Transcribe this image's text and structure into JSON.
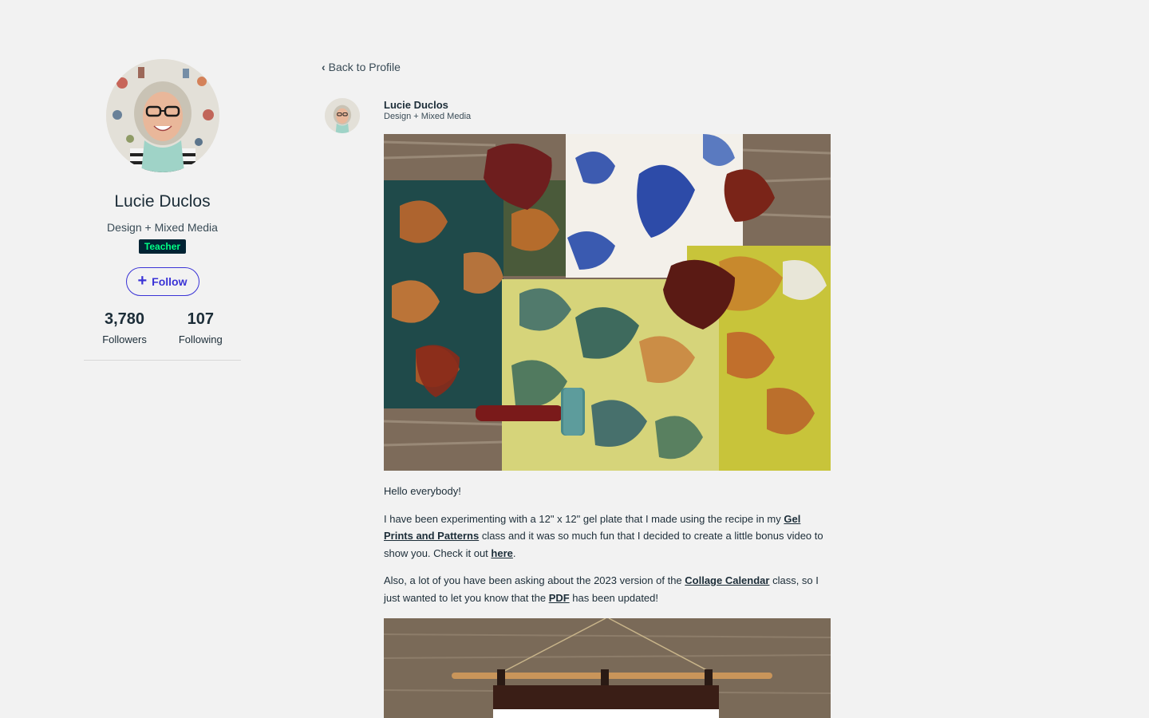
{
  "profile": {
    "name": "Lucie Duclos",
    "subtitle": "Design + Mixed Media",
    "badge": "Teacher",
    "follow_label": "Follow",
    "followers_count": "3,780",
    "followers_label": "Followers",
    "following_count": "107",
    "following_label": "Following"
  },
  "nav": {
    "back_label": "Back to Profile"
  },
  "post": {
    "author_name": "Lucie Duclos",
    "author_subtitle": "Design + Mixed Media",
    "greeting": "Hello everybody!",
    "p1_a": "I have been experimenting with a 12\" x 12\" gel plate that I made using the recipe in my ",
    "p1_link1": "Gel Prints and Patterns",
    "p1_b": " class and it was so much fun that I decided to create a little bonus video to show you. Check it out ",
    "p1_link2": "here",
    "p1_c": ".",
    "p2_a": "Also, a lot of you have been asking about the 2023 version of the ",
    "p2_link1": "Collage Calendar",
    "p2_b": " class, so I just wanted to let you know that the ",
    "p2_link2": "PDF",
    "p2_c": " has been updated!"
  },
  "colors": {
    "background": "#f2f2f2",
    "accent": "#3a33d6",
    "badge_bg": "#002333",
    "badge_text": "#00ff84",
    "text": "#1c2d38"
  },
  "icons": {
    "back": "chevron-left-icon",
    "follow": "plus-icon"
  }
}
